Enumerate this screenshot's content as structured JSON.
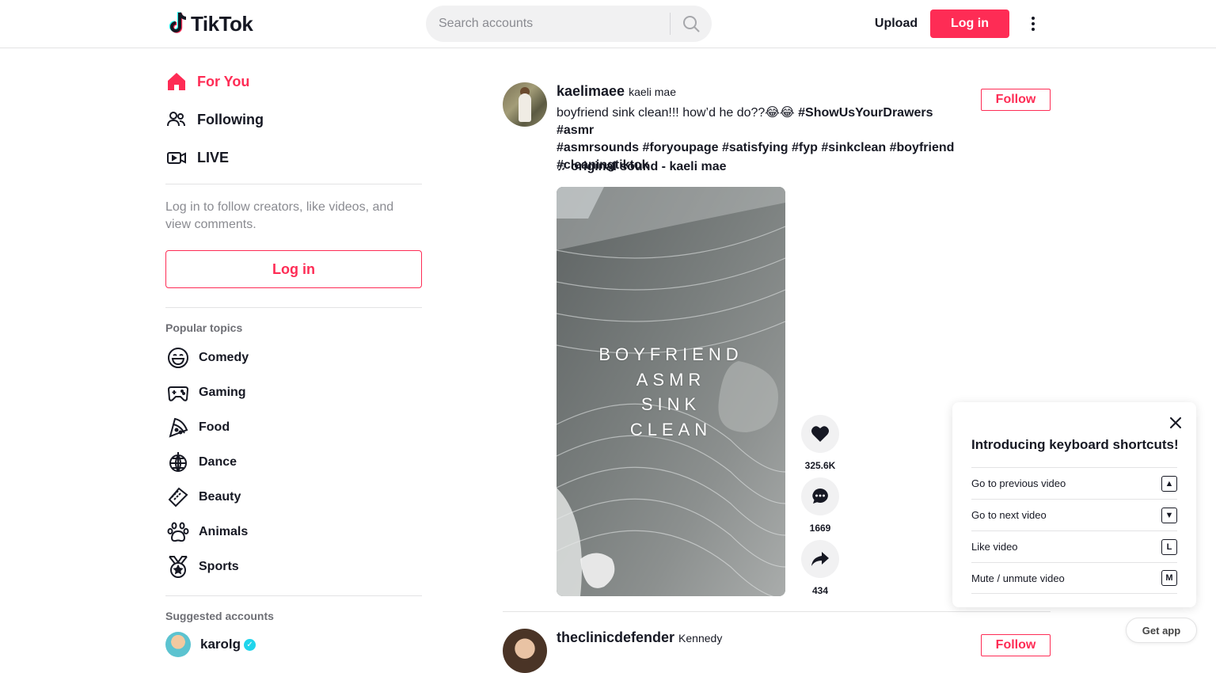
{
  "header": {
    "logo_text": "TikTok",
    "search_placeholder": "Search accounts",
    "upload_label": "Upload",
    "login_label": "Log in"
  },
  "sidebar": {
    "nav": [
      {
        "label": "For You",
        "icon": "home-icon",
        "active": true
      },
      {
        "label": "Following",
        "icon": "following-icon"
      },
      {
        "label": "LIVE",
        "icon": "live-icon"
      }
    ],
    "login_hint": "Log in to follow creators, like videos, and view comments.",
    "login_button": "Log in",
    "popular_topics_title": "Popular topics",
    "topics": [
      {
        "label": "Comedy",
        "icon": "comedy-icon"
      },
      {
        "label": "Gaming",
        "icon": "gaming-icon"
      },
      {
        "label": "Food",
        "icon": "food-icon"
      },
      {
        "label": "Dance",
        "icon": "dance-icon"
      },
      {
        "label": "Beauty",
        "icon": "beauty-icon"
      },
      {
        "label": "Animals",
        "icon": "animals-icon"
      },
      {
        "label": "Sports",
        "icon": "sports-icon"
      }
    ],
    "suggested_title": "Suggested accounts",
    "suggested": [
      {
        "name": "karolg",
        "verified": true
      }
    ]
  },
  "posts": [
    {
      "username": "kaelimaee",
      "nickname": "kaeli mae",
      "caption_text": "boyfriend sink clean!!! how’d he do??😂😂 ",
      "hashtags_line1": "#ShowUsYourDrawers #asmr",
      "hashtags_line2": "#asmrsounds #foryoupage #satisfying #fyp #sinkclean #boyfriend",
      "hashtags_line3": "#cleaningtiktok",
      "sound": "original sound - kaeli mae",
      "follow_label": "Follow",
      "video_overlay": [
        "BOYFRIEND",
        "ASMR",
        "SINK",
        "CLEAN"
      ],
      "likes": "325.6K",
      "comments": "1669",
      "shares": "434"
    },
    {
      "username": "theclinicdefender",
      "nickname": "Kennedy",
      "follow_label": "Follow"
    }
  ],
  "shortcuts": {
    "title": "Introducing keyboard shortcuts!",
    "rows": [
      {
        "label": "Go to previous video",
        "key": "▲"
      },
      {
        "label": "Go to next video",
        "key": "▼"
      },
      {
        "label": "Like video",
        "key": "L"
      },
      {
        "label": "Mute / unmute video",
        "key": "M"
      }
    ]
  },
  "get_app": "Get app",
  "colors": {
    "accent": "#fe2c55",
    "text": "#161823",
    "muted": "#8a8b91",
    "verified": "#20d5ec"
  }
}
